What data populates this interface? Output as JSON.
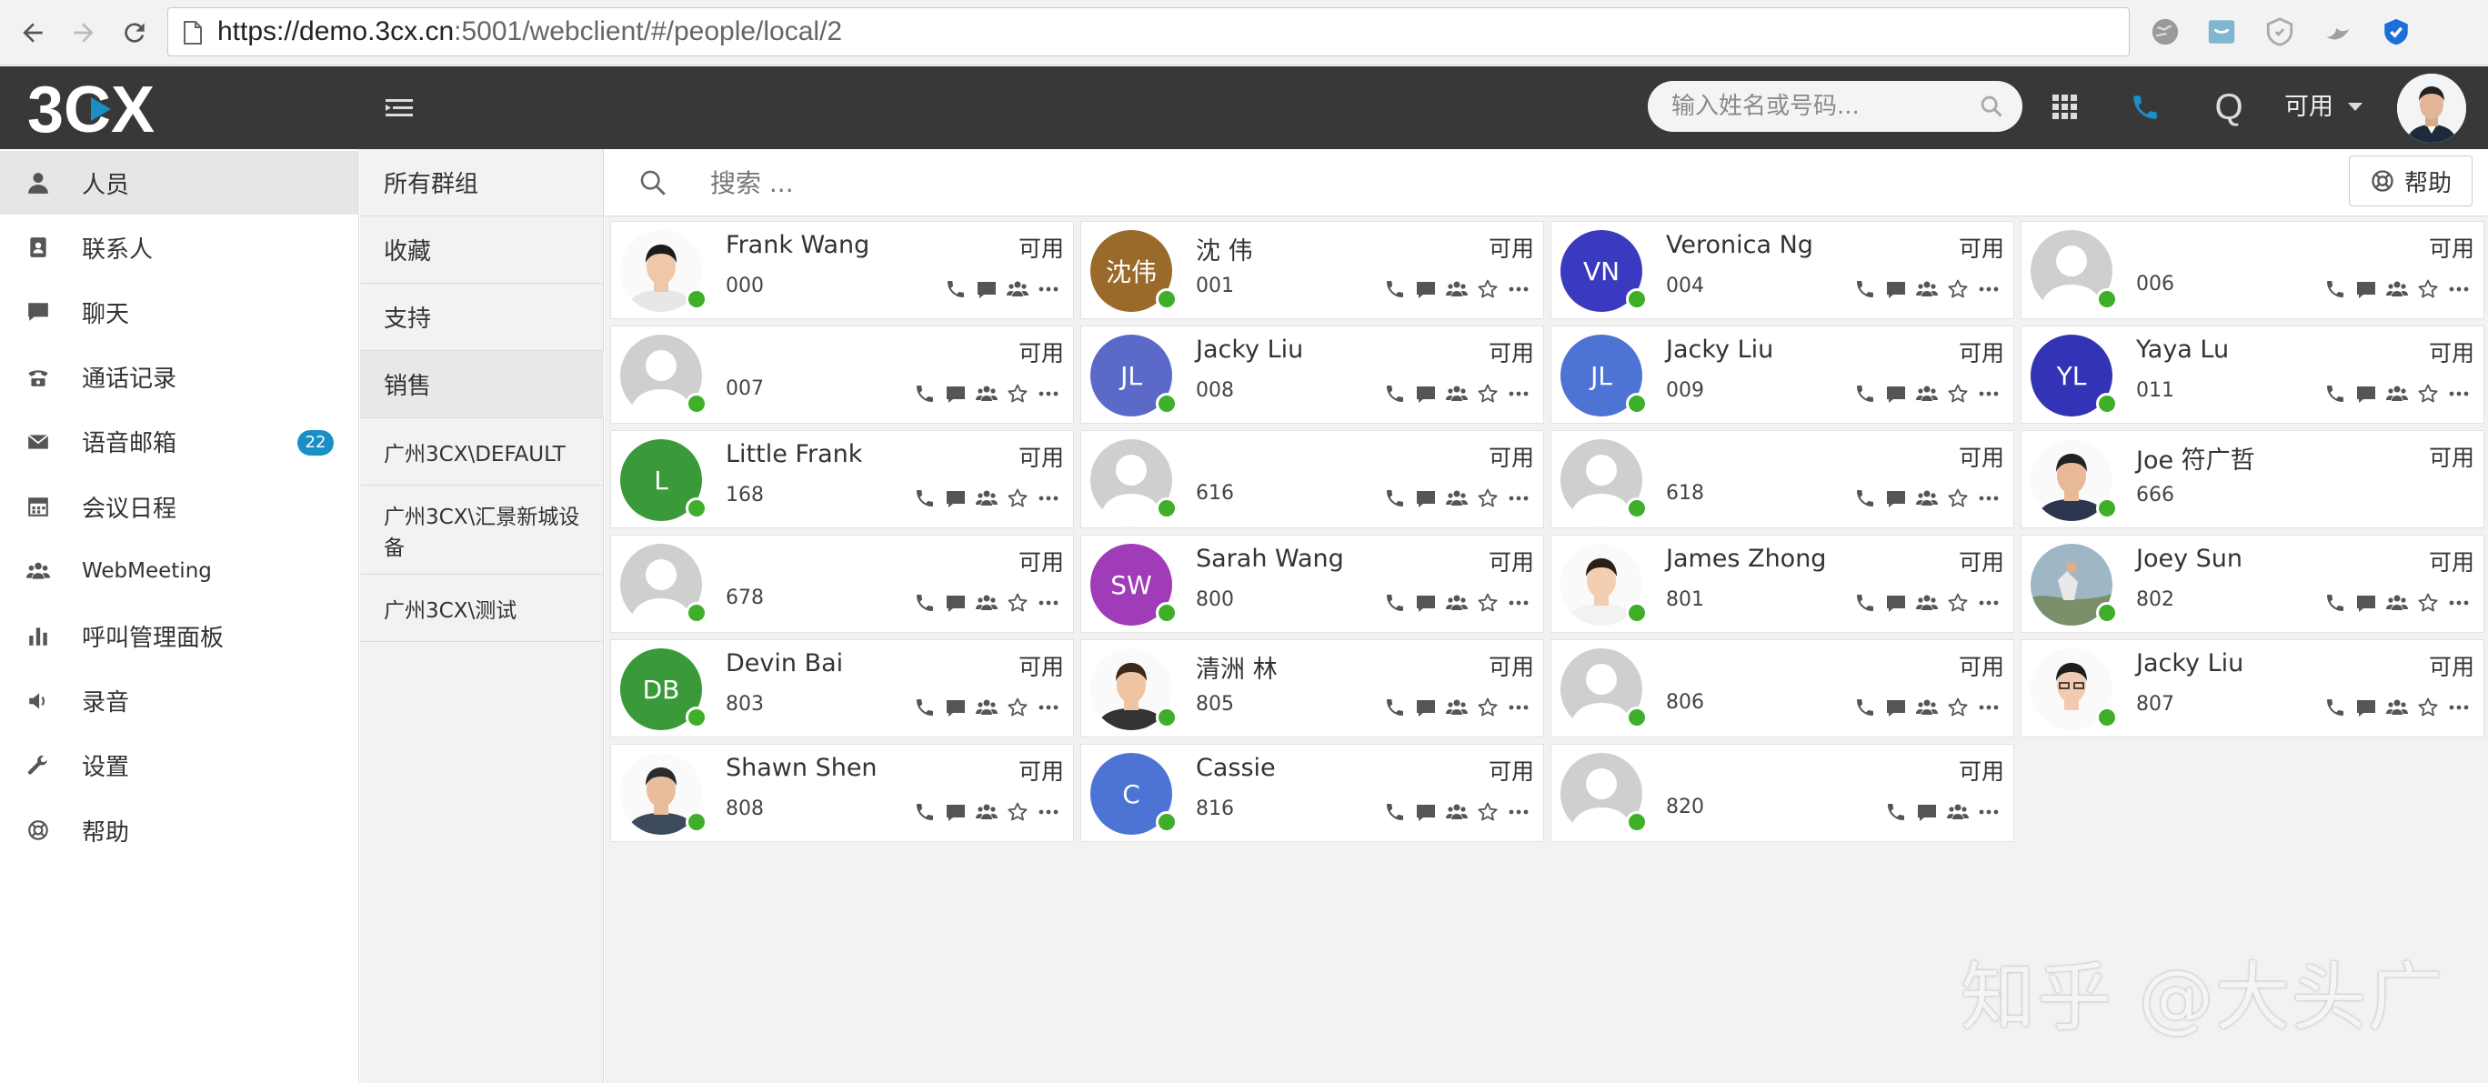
{
  "browser": {
    "url_host": "https://demo.3cx.cn",
    "url_rest": ":5001/webclient/#/people/local/2"
  },
  "header": {
    "logo_text": "3CX",
    "search_placeholder": "输入姓名或号码...",
    "queue_label": "Q",
    "status": "可用",
    "icons": [
      "menu-toggle-icon",
      "dialpad-grid-icon",
      "phone-icon",
      "search-icon"
    ]
  },
  "nav": {
    "items": [
      {
        "label": "人员",
        "icon": "person-icon",
        "active": true
      },
      {
        "label": "联系人",
        "icon": "address-book-icon"
      },
      {
        "label": "聊天",
        "icon": "chat-icon"
      },
      {
        "label": "通话记录",
        "icon": "call-history-icon"
      },
      {
        "label": "语音邮箱",
        "icon": "envelope-icon",
        "badge": "22"
      },
      {
        "label": "会议日程",
        "icon": "calendar-icon"
      },
      {
        "label": "WebMeeting",
        "icon": "group-icon"
      },
      {
        "label": "呼叫管理面板",
        "icon": "bar-chart-icon"
      },
      {
        "label": "录音",
        "icon": "speaker-icon"
      },
      {
        "label": "设置",
        "icon": "wrench-icon"
      },
      {
        "label": "帮助",
        "icon": "lifebuoy-icon"
      }
    ]
  },
  "groups": {
    "items": [
      {
        "label": "所有群组"
      },
      {
        "label": "收藏"
      },
      {
        "label": "支持"
      },
      {
        "label": "销售",
        "active": true
      },
      {
        "label": "广州3CX\\DEFAULT"
      },
      {
        "label": "广州3CX\\汇景新城设备"
      },
      {
        "label": "广州3CX\\测试"
      }
    ]
  },
  "main": {
    "search_placeholder": "搜索 ...",
    "help_label": "帮助"
  },
  "contacts": [
    {
      "name": "Frank Wang",
      "ext": "000",
      "status": "可用",
      "avatar": "photo",
      "favorite": false
    },
    {
      "name": "沈 伟",
      "ext": "001",
      "status": "可用",
      "avatar": "initials",
      "initials": "沈伟",
      "color": "#9a6a2a",
      "favorite": true
    },
    {
      "name": "Veronica Ng",
      "ext": "004",
      "status": "可用",
      "avatar": "initials",
      "initials": "VN",
      "color": "#3a3ac0",
      "favorite": true
    },
    {
      "name": "",
      "ext": "006",
      "status": "可用",
      "avatar": "default",
      "favorite": true
    },
    {
      "name": "",
      "ext": "007",
      "status": "可用",
      "avatar": "default",
      "favorite": true
    },
    {
      "name": "Jacky Liu",
      "ext": "008",
      "status": "可用",
      "avatar": "initials",
      "initials": "JL",
      "color": "#5b6ac8",
      "favorite": true
    },
    {
      "name": "Jacky Liu",
      "ext": "009",
      "status": "可用",
      "avatar": "initials",
      "initials": "JL",
      "color": "#4d73d4",
      "favorite": true
    },
    {
      "name": "Yaya Lu",
      "ext": "011",
      "status": "可用",
      "avatar": "initials",
      "initials": "YL",
      "color": "#3333b8",
      "favorite": true
    },
    {
      "name": "Little Frank",
      "ext": "168",
      "status": "可用",
      "avatar": "initials",
      "initials": "L",
      "color": "#3a9a3a",
      "favorite": true
    },
    {
      "name": "",
      "ext": "616",
      "status": "可用",
      "avatar": "default",
      "favorite": true
    },
    {
      "name": "",
      "ext": "618",
      "status": "可用",
      "avatar": "default",
      "favorite": true
    },
    {
      "name": "Joe 符广哲",
      "ext": "666",
      "status": "可用",
      "avatar": "photo",
      "favorite": false,
      "no_actions": true
    },
    {
      "name": "",
      "ext": "678",
      "status": "可用",
      "avatar": "default",
      "favorite": true
    },
    {
      "name": "Sarah Wang",
      "ext": "800",
      "status": "可用",
      "avatar": "initials",
      "initials": "SW",
      "color": "#a03cb8",
      "favorite": true
    },
    {
      "name": "James Zhong",
      "ext": "801",
      "status": "可用",
      "avatar": "photo",
      "favorite": true
    },
    {
      "name": "Joey Sun",
      "ext": "802",
      "status": "可用",
      "avatar": "photo",
      "favorite": true
    },
    {
      "name": "Devin Bai",
      "ext": "803",
      "status": "可用",
      "avatar": "initials",
      "initials": "DB",
      "color": "#3a9a3a",
      "favorite": true
    },
    {
      "name": "清洲 林",
      "ext": "805",
      "status": "可用",
      "avatar": "photo",
      "favorite": true
    },
    {
      "name": "",
      "ext": "806",
      "status": "可用",
      "avatar": "default",
      "favorite": true
    },
    {
      "name": "Jacky Liu",
      "ext": "807",
      "status": "可用",
      "avatar": "photo",
      "favorite": true
    },
    {
      "name": "Shawn Shen",
      "ext": "808",
      "status": "可用",
      "avatar": "photo",
      "favorite": true
    },
    {
      "name": "Cassie",
      "ext": "816",
      "status": "可用",
      "avatar": "initials",
      "initials": "C",
      "color": "#4d73d4",
      "favorite": true
    },
    {
      "name": "",
      "ext": "820",
      "status": "可用",
      "avatar": "default",
      "favorite": false
    }
  ],
  "watermark": "知乎 @大头广",
  "colors": {
    "header_bg": "#383838",
    "accent_blue": "#1a8fc5",
    "presence_green": "#3fae29"
  }
}
